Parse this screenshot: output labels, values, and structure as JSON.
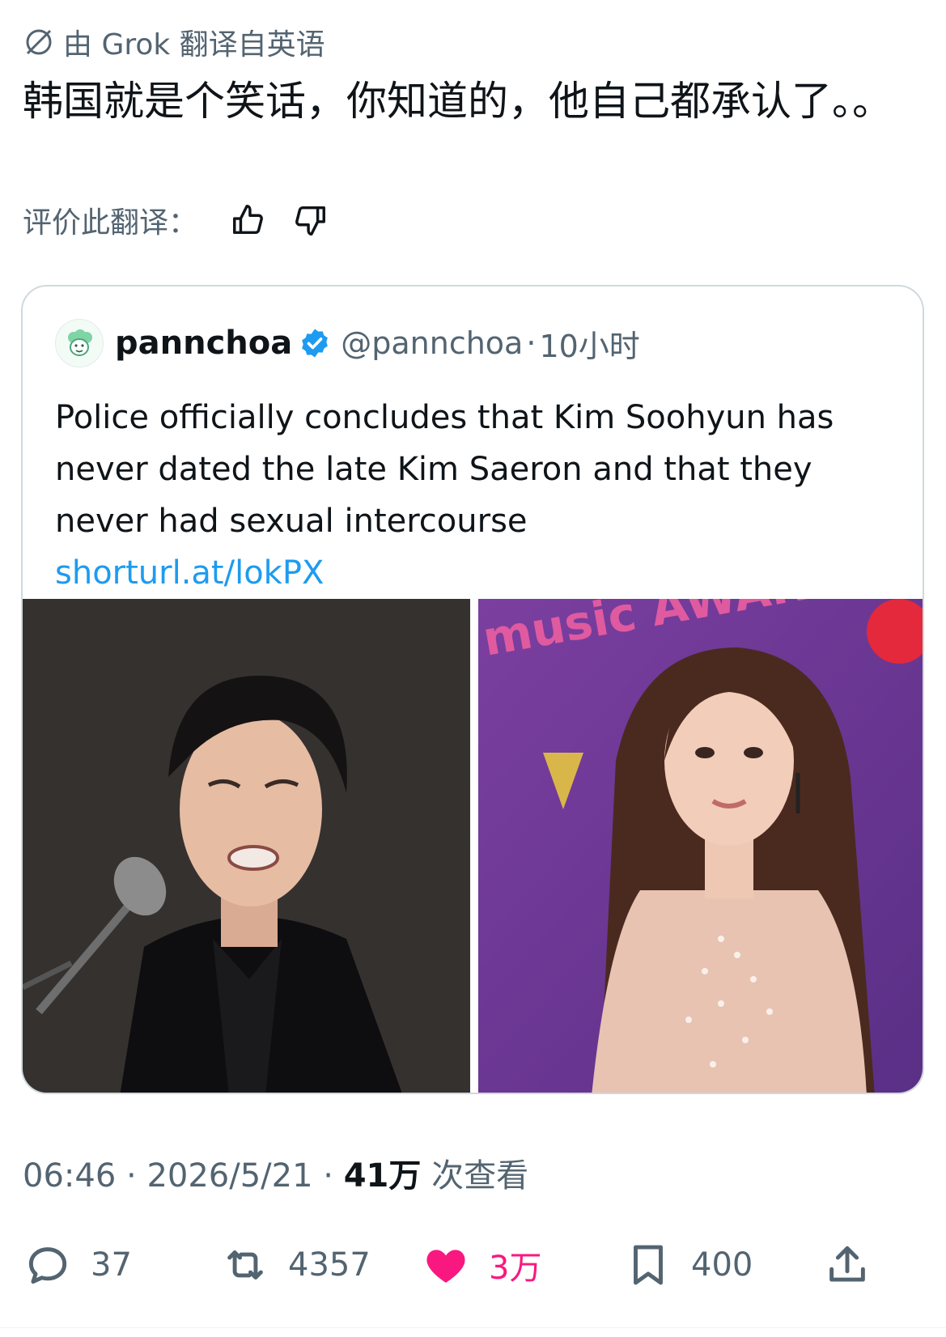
{
  "translation": {
    "label": "由 Grok 翻译自英语",
    "text": "韩国就是个笑话，你知道的，他自己都承认了。。",
    "rate_label": "评价此翻译："
  },
  "quoted_tweet": {
    "name": "pannchoa",
    "handle": "@pannchoa",
    "separator": "·",
    "time": "10小时",
    "text": "Police officially concludes that Kim Soohyun has never dated the late Kim Saeron and that they never had sexual intercourse",
    "link": "shorturl.at/lokPX",
    "photo_left_backdrop": "",
    "photo_right_backdrop": "music AWARDS"
  },
  "meta": {
    "time": "06:46",
    "sep1": "·",
    "date": "2026/5/21",
    "sep2": "·",
    "views_count": "41万",
    "views_label": "次查看"
  },
  "actions": {
    "replies": "37",
    "reposts": "4357",
    "likes": "3万",
    "bookmarks": "400"
  },
  "colors": {
    "text": "#0f1419",
    "muted": "#536471",
    "link": "#1d9bf0",
    "like": "#f91880",
    "verified": "#1d9bf0",
    "border": "#cfd9de"
  }
}
